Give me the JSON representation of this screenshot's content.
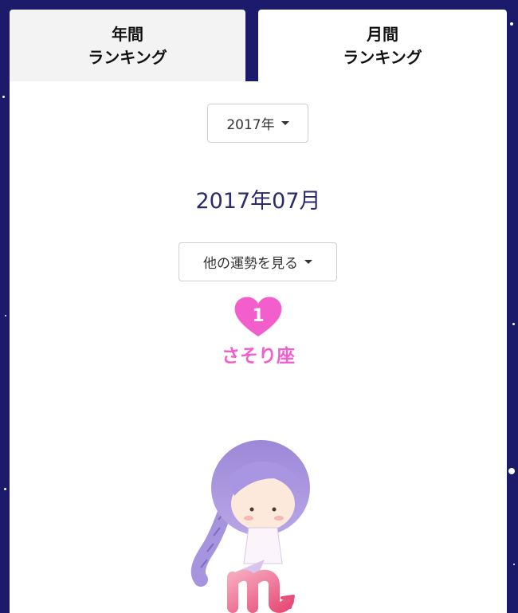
{
  "tabs": [
    {
      "line1": "年間",
      "line2": "ランキング"
    },
    {
      "line1": "月間",
      "line2": "ランキング"
    }
  ],
  "year_select": {
    "label": "2017年"
  },
  "month_title": "2017年07月",
  "other_fortune_select": {
    "label": "他の運勢を見る"
  },
  "ranking": {
    "rank": "1",
    "sign": "さそり座"
  },
  "colors": {
    "background": "#1c1a6b",
    "accent_pink": "#f25fcd",
    "title": "#2a2a6e"
  },
  "illustration": {
    "icon": "scorpio-girl-illustration"
  }
}
